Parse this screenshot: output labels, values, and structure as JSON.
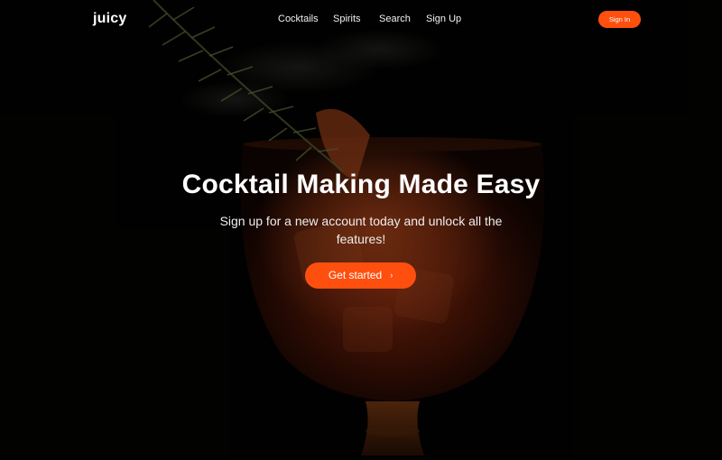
{
  "brand": {
    "logo_text": "juicy"
  },
  "nav": {
    "links": [
      {
        "label": "Cocktails"
      },
      {
        "label": "Spirits"
      },
      {
        "label": "Search"
      },
      {
        "label": "Sign Up"
      }
    ],
    "signin_label": "Sign In"
  },
  "hero": {
    "title": "Cocktail Making Made Easy",
    "subtitle": "Sign up for a new account today and unlock all the features!",
    "cta_label": "Get started",
    "cta_icon": "chevron-right-icon",
    "background_image": "cocktail-glass-with-rosemary-photo"
  },
  "colors": {
    "accent": "#ff4f0f",
    "background": "#000000",
    "text": "#ffffff"
  }
}
